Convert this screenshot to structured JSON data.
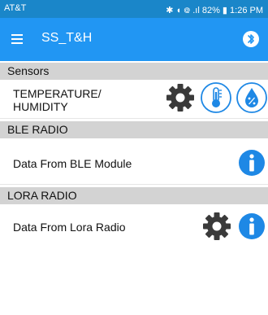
{
  "status_bar": {
    "carrier": "AT&T",
    "right_text": "✱ ◖ ᪤ .ıl 82% ▮ 1:26 PM"
  },
  "app_bar": {
    "title": "SS_T&H",
    "menu_icon": "hamburger-menu-icon",
    "bluetooth_icon": "bluetooth-icon"
  },
  "sections": [
    {
      "header": "Sensors",
      "row_label_line1": "TEMPERATURE/",
      "row_label_line2": "HUMIDITY",
      "icons": [
        "gear-icon",
        "thermometer-icon",
        "humidity-drop-icon"
      ]
    },
    {
      "header": "BLE RADIO",
      "row_label": "Data From BLE Module",
      "icons": [
        "info-icon"
      ]
    },
    {
      "header": "LORA RADIO",
      "row_label": "Data From Lora Radio",
      "icons": [
        "gear-icon",
        "info-icon"
      ]
    }
  ],
  "colors": {
    "status_bar": "#1a86c9",
    "app_bar": "#2196f3",
    "section_header": "#d3d3d3",
    "accent_blue": "#1e88e5",
    "gear": "#3a3a3a"
  }
}
